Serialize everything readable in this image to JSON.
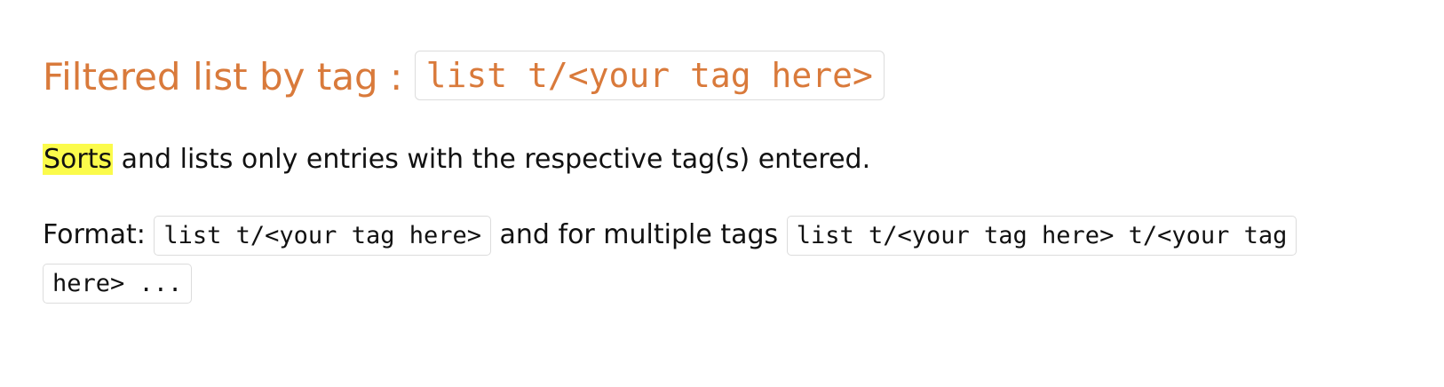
{
  "heading": {
    "text": "Filtered list by tag : ",
    "code": "list t/<your tag here>"
  },
  "description": {
    "highlight": "Sorts",
    "rest": " and lists only entries with the respective tag(s) entered."
  },
  "format": {
    "label": "Format: ",
    "code_single": "list t/<your tag here>",
    "middle": " and for multiple tags ",
    "code_multi_line1": "list t/<your tag here> t/<your tag",
    "code_multi_line2": "here> ..."
  },
  "colors": {
    "heading": "#d97a3b",
    "highlight": "#fbfb4b",
    "code_border": "#dcdcdc",
    "text": "#111111"
  }
}
